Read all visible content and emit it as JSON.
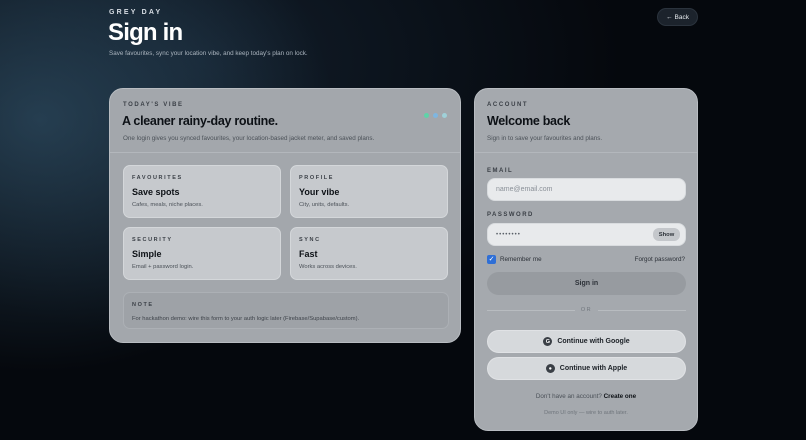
{
  "header": {
    "brand": "GREY DAY",
    "title": "Sign in",
    "subtitle": "Save favourites, sync your location vibe, and keep today's plan on lock.",
    "back_label": "Back",
    "back_icon": "arrow-left-icon"
  },
  "vibe": {
    "eyebrow": "TODAY'S VIBE",
    "heading": "A cleaner rainy-day routine.",
    "description": "One login gives you synced favourites, your location-based jacket meter, and saved plans.",
    "dot_colors": [
      "#5fd3a8",
      "#7fb6e0",
      "#9fd0d8"
    ],
    "tiles": [
      {
        "eyebrow": "FAVOURITES",
        "value": "Save spots",
        "sub": "Cafes, meals, niche places."
      },
      {
        "eyebrow": "PROFILE",
        "value": "Your vibe",
        "sub": "City, units, defaults."
      },
      {
        "eyebrow": "SECURITY",
        "value": "Simple",
        "sub": "Email + password login."
      },
      {
        "eyebrow": "SYNC",
        "value": "Fast",
        "sub": "Works across devices."
      }
    ],
    "note": {
      "eyebrow": "NOTE",
      "text": "For hackathon demo: wire this form to your auth logic later (Firebase/Supabase/custom)."
    }
  },
  "account": {
    "eyebrow": "ACCOUNT",
    "heading": "Welcome back",
    "description": "Sign in to save your favourites and plans.",
    "email_label": "EMAIL",
    "email_placeholder": "name@email.com",
    "password_label": "PASSWORD",
    "password_value": "••••••••",
    "show_label": "Show",
    "remember_label": "Remember me",
    "remember_checked": true,
    "forgot_label": "Forgot password?",
    "signin_label": "Sign in",
    "or_label": "OR",
    "google_label": "Continue with Google",
    "google_icon": "G",
    "apple_label": "Continue with Apple",
    "apple_icon": "apple-icon",
    "signup_prompt": "Don't have an account?",
    "signup_link": "Create one",
    "demo_note": "Demo UI only — wire to auth later."
  }
}
